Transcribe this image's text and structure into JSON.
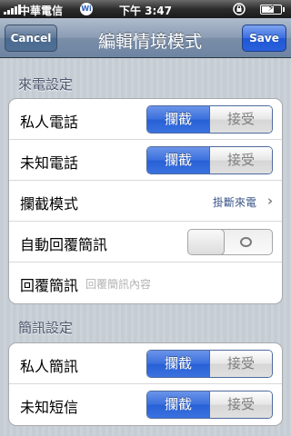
{
  "status_bar": {
    "carrier": "中華電信",
    "wifi_label": "Wi",
    "time": "下午 3:47",
    "battery_level": 0.6,
    "icons": [
      "signal-icon",
      "wifi-icon",
      "rotation-lock-icon",
      "battery-icon"
    ]
  },
  "navbar": {
    "cancel_label": "Cancel",
    "title": "編輯情境模式",
    "save_label": "Save"
  },
  "sections": {
    "call": {
      "header": "來電設定",
      "private_call": {
        "label": "私人電話",
        "options": [
          "攔截",
          "接受"
        ],
        "selected": "攔截"
      },
      "unknown_call": {
        "label": "未知電話",
        "options": [
          "攔截",
          "接受"
        ],
        "selected": "攔截"
      },
      "block_mode": {
        "label": "攔截模式",
        "value": "掛斷來電"
      },
      "auto_reply": {
        "label": "自動回覆簡訊",
        "state": "off"
      },
      "reply_sms": {
        "label": "回覆簡訊",
        "placeholder": "回覆簡訊內容"
      }
    },
    "sms": {
      "header": "簡訊設定",
      "private_sms": {
        "label": "私人簡訊",
        "options": [
          "攔截",
          "接受"
        ],
        "selected": "攔截"
      },
      "unknown_sms": {
        "label": "未知短信",
        "options": [
          "攔截",
          "接受"
        ],
        "selected": "攔截"
      }
    }
  },
  "colors": {
    "segment_selected": "#3a6fdc",
    "nav_save": "#2a60da",
    "link_value": "#385487"
  }
}
